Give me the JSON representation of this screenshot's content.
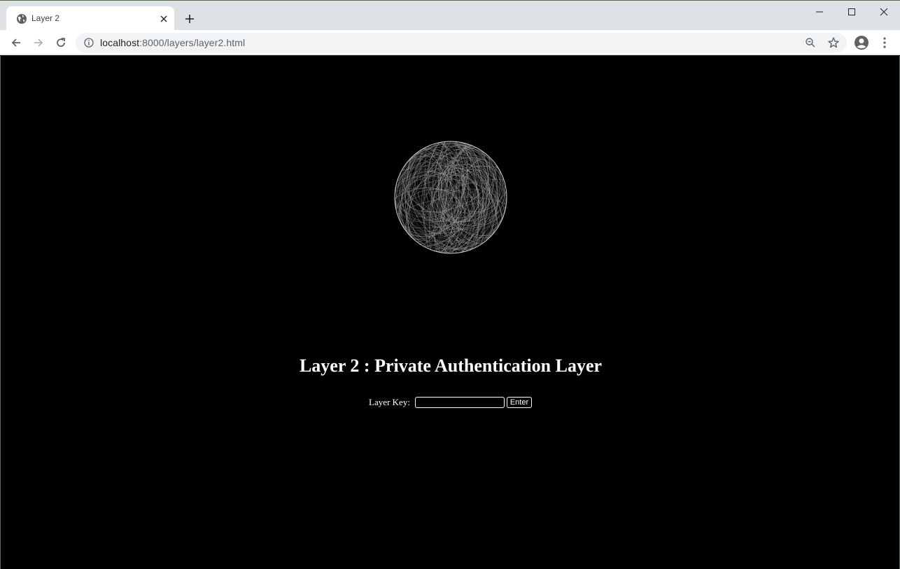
{
  "browser": {
    "tab_title": "Layer 2",
    "url_host": "localhost",
    "url_path": ":8000/layers/layer2.html",
    "icons": [
      "globe-icon",
      "close-icon",
      "plus-icon",
      "minimize-icon",
      "maximize-icon",
      "window-close-icon",
      "back-icon",
      "forward-icon",
      "reload-icon",
      "info-icon",
      "zoom-out-icon",
      "star-icon",
      "profile-icon",
      "menu-icon"
    ]
  },
  "page": {
    "heading": "Layer 2 : Private Authentication Layer",
    "form": {
      "label": "Layer Key:",
      "input_value": "",
      "button_label": "Enter"
    },
    "colors": {
      "background": "#000000",
      "foreground": "#ffffff"
    }
  }
}
